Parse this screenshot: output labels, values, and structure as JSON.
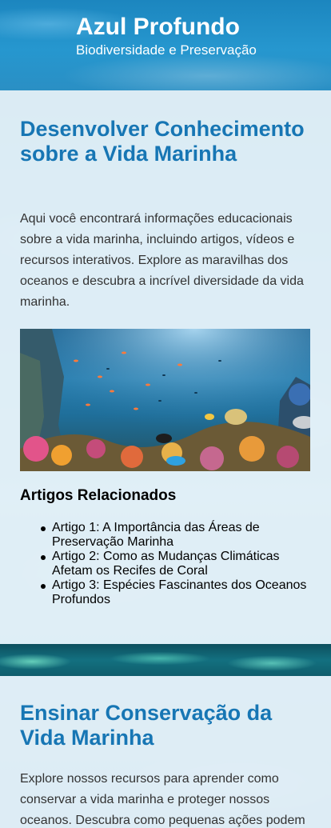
{
  "header": {
    "title": "Azul Profundo",
    "subtitle": "Biodiversidade e Preservação"
  },
  "section1": {
    "title": "Desenvolver Conhecimento sobre a Vida Marinha",
    "text": "Aqui você encontrará informações educacionais sobre a vida marinha, incluindo artigos, vídeos e recursos interativos. Explore as maravilhas dos oceanos e descubra a incrível diversidade da vida marinha.",
    "image_icon": "coral-reef-image",
    "related": {
      "title": "Artigos Relacionados",
      "items": [
        "Artigo 1: A Importância das Áreas de Preservação Marinha",
        "Artigo 2: Como as Mudanças Climáticas Afetam os Recifes de Coral",
        "Artigo 3: Espécies Fascinantes dos Oceanos Profundos"
      ]
    }
  },
  "section2": {
    "title": "Ensinar Conservação da Vida Marinha",
    "text": "Explore nossos recursos para aprender como conservar a vida marinha e proteger nossos oceanos. Descubra como pequenas ações podem"
  },
  "colors": {
    "accent": "#1776b4",
    "header": "#2697cf",
    "section_bg": "#eef6fb"
  }
}
